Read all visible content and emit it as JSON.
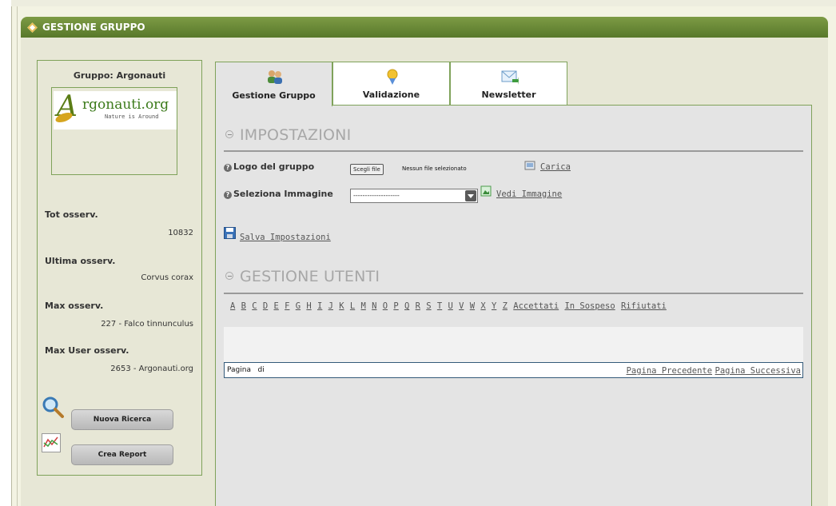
{
  "header": {
    "title": "GESTIONE GRUPPO"
  },
  "sidebar": {
    "group_title": "Gruppo: Argonauti",
    "logo": {
      "brand": "rgonauti.org",
      "initial": "A",
      "tagline": "Nature is Around"
    },
    "stats": [
      {
        "label": "Tot osserv.",
        "value": "10832"
      },
      {
        "label": "Ultima osserv.",
        "value": "Corvus corax"
      },
      {
        "label": "Max osserv.",
        "value": "227 - Falco tinnunculus"
      },
      {
        "label": "Max User osserv.",
        "value": "2653 - Argonauti.org"
      }
    ],
    "actions": [
      {
        "label": "Nuova Ricerca",
        "icon": "magnifier-icon"
      },
      {
        "label": "Crea Report",
        "icon": "chart-icon"
      }
    ]
  },
  "tabs": [
    {
      "label": "Gestione Gruppo",
      "icon": "group-icon",
      "active": true
    },
    {
      "label": "Validazione",
      "icon": "award-icon",
      "active": false
    },
    {
      "label": "Newsletter",
      "icon": "mail-icon",
      "active": false
    }
  ],
  "impostazioni": {
    "title": "IMPOSTAZIONI",
    "logo_label": "Logo del gruppo",
    "file_button": "Scegli file",
    "file_status": "Nessun file selezionato",
    "upload_link": "Carica",
    "image_label": "Seleziona Immagine",
    "image_select_value": "--------------------",
    "view_link": "Vedi Immagine",
    "save_link": "Salva Impostazioni"
  },
  "gestione_utenti": {
    "title": "GESTIONE UTENTI",
    "letters": [
      "A",
      "B",
      "C",
      "D",
      "E",
      "F",
      "G",
      "H",
      "I",
      "J",
      "K",
      "L",
      "M",
      "N",
      "O",
      "P",
      "Q",
      "R",
      "S",
      "T",
      "U",
      "V",
      "W",
      "X",
      "Y",
      "Z"
    ],
    "filters": [
      "Accettati",
      "In Sospeso",
      "Rifiutati"
    ],
    "pager": {
      "left_text": "Pagina   di",
      "prev": "Pagina Precedente",
      "next": "Pagina Successiva"
    }
  },
  "colors": {
    "accent_green": "#5b7d22",
    "border_green": "#7fa25a",
    "panel_bg": "#e4e4e4"
  }
}
